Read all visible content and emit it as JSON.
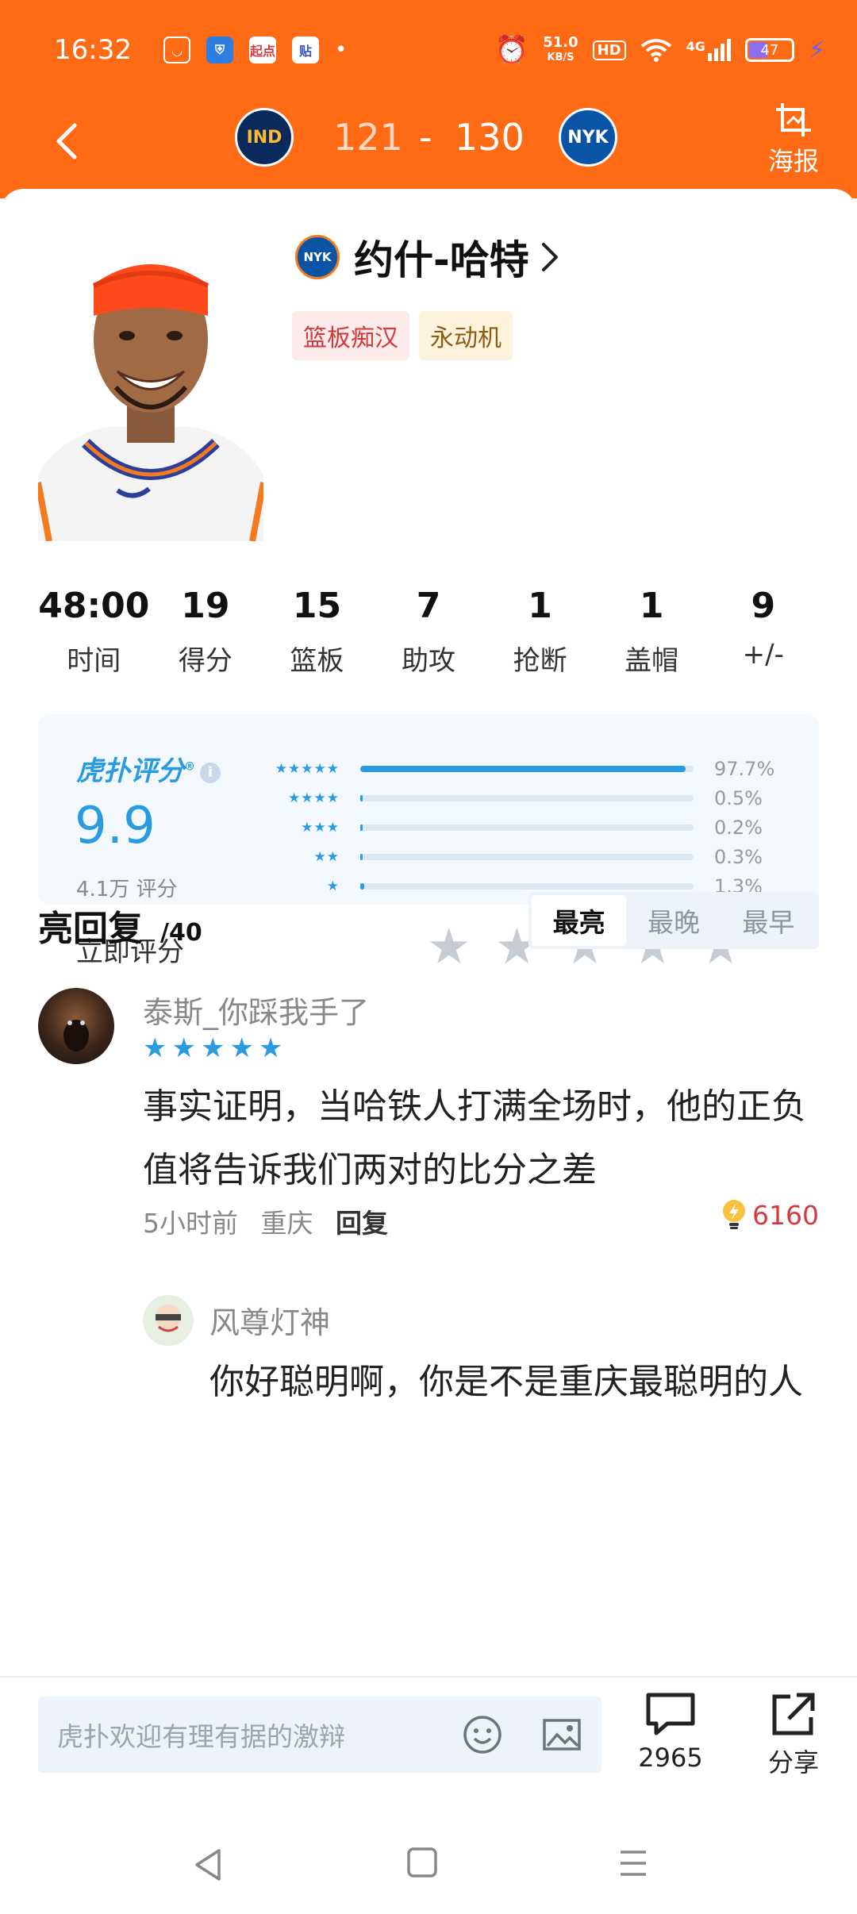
{
  "status_bar": {
    "time": "16:32",
    "apps": [
      "起点",
      "贴"
    ],
    "network_speed": "51.0",
    "speed_unit": "KB/S",
    "hd": "HD",
    "signal": "4G",
    "battery": "47"
  },
  "game": {
    "home_team": "IND",
    "home_score": "121",
    "separator": "-",
    "away_score": "130",
    "away_team": "NYK",
    "poster_label": "海报"
  },
  "player": {
    "team_badge": "NYK",
    "name": "约什-哈特",
    "tags": [
      "篮板痴汉",
      "永动机"
    ]
  },
  "stats": [
    {
      "value": "48:00",
      "label": "时间"
    },
    {
      "value": "19",
      "label": "得分"
    },
    {
      "value": "15",
      "label": "篮板"
    },
    {
      "value": "7",
      "label": "助攻"
    },
    {
      "value": "1",
      "label": "抢断"
    },
    {
      "value": "1",
      "label": "盖帽"
    },
    {
      "value": "9",
      "label": "+/-"
    }
  ],
  "rating": {
    "brand": "虎扑评分",
    "reg_mark": "®",
    "info": "i",
    "score": "9.9",
    "count": "4.1万 评分",
    "distribution": [
      {
        "stars": "★★★★★",
        "percent": "97.7%",
        "fraction": 0.977
      },
      {
        "stars": "★★★★",
        "percent": "0.5%",
        "fraction": 0.005
      },
      {
        "stars": "★★★",
        "percent": "0.2%",
        "fraction": 0.002
      },
      {
        "stars": "★★",
        "percent": "0.3%",
        "fraction": 0.003
      },
      {
        "stars": "★",
        "percent": "1.3%",
        "fraction": 0.013
      }
    ],
    "rate_now": "立即评分"
  },
  "replies": {
    "title": "亮回复",
    "count": "/40",
    "sort": [
      "最亮",
      "最晚",
      "最早"
    ],
    "comment": {
      "user": "泰斯_你踩我手了",
      "stars": "★★★★★",
      "text": "事实证明，当哈铁人打满全场时，他的正负值将告诉我们两对的比分之差",
      "time": "5小时前",
      "city": "重庆",
      "reply": "回复",
      "likes": "6160"
    },
    "sub_reply": {
      "user": "风尊灯神",
      "text": "你好聪明啊，你是不是重庆最聪明的人"
    }
  },
  "bottom": {
    "placeholder": "虎扑欢迎有理有据的激辩",
    "comments_count": "2965",
    "share_label": "分享"
  },
  "colors": {
    "header": "#ff6a14",
    "accent": "#2a9be0",
    "like_red": "#d23b3b"
  }
}
